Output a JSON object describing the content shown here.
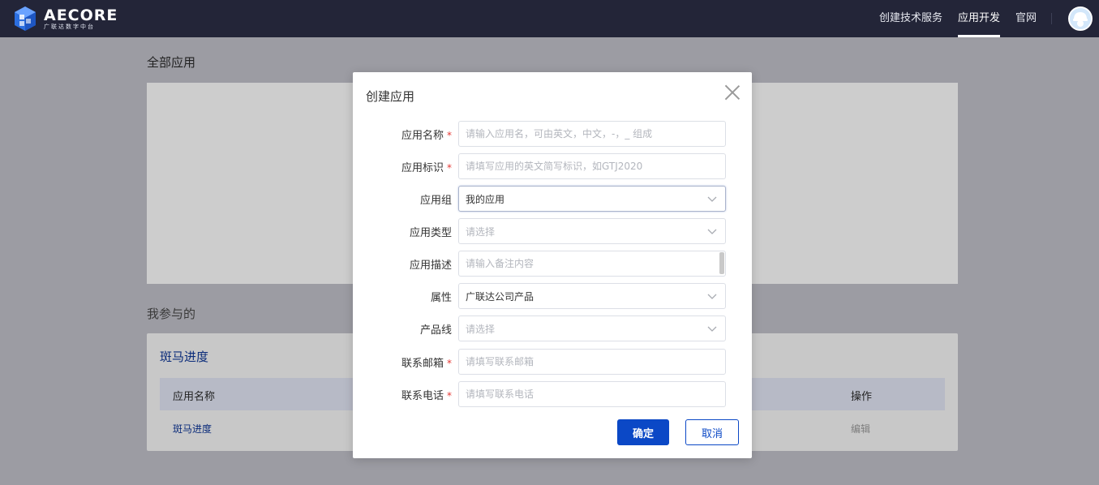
{
  "brand": {
    "name": "AECORE",
    "subtitle": "广联达数字中台"
  },
  "nav": {
    "items": [
      {
        "label": "创建技术服务",
        "active": false
      },
      {
        "label": "应用开发",
        "active": true
      },
      {
        "label": "官网",
        "active": false
      }
    ]
  },
  "page": {
    "all_apps_title": "全部应用",
    "participated_title": "我参与的",
    "card": {
      "title": "斑马进度",
      "columns": [
        "应用名称",
        "操作"
      ],
      "rows": [
        {
          "name": "斑马进度",
          "action": "编辑"
        }
      ]
    }
  },
  "dialog": {
    "title": "创建应用",
    "fields": {
      "app_name": {
        "label": "应用名称",
        "required": true,
        "placeholder": "请输入应用名，可由英文，中文，-，_ 组成"
      },
      "app_id": {
        "label": "应用标识",
        "required": true,
        "placeholder": "请填写应用的英文简写标识，如GTJ2020"
      },
      "app_group": {
        "label": "应用组",
        "required": false,
        "value": "我的应用"
      },
      "app_type": {
        "label": "应用类型",
        "required": false,
        "placeholder": "请选择"
      },
      "app_desc": {
        "label": "应用描述",
        "required": false,
        "placeholder": "请输入备注内容"
      },
      "attribute": {
        "label": "属性",
        "required": false,
        "value": "广联达公司产品"
      },
      "product_line": {
        "label": "产品线",
        "required": false,
        "placeholder": "请选择"
      },
      "email": {
        "label": "联系邮箱",
        "required": true,
        "placeholder": "请填写联系邮箱"
      },
      "phone": {
        "label": "联系电话",
        "required": true,
        "placeholder": "请填写联系电话"
      }
    },
    "required_mark": "*",
    "confirm_label": "确定",
    "cancel_label": "取消"
  },
  "colors": {
    "topbar": "#232538",
    "primary": "#0b48c6",
    "required": "#e53935"
  }
}
